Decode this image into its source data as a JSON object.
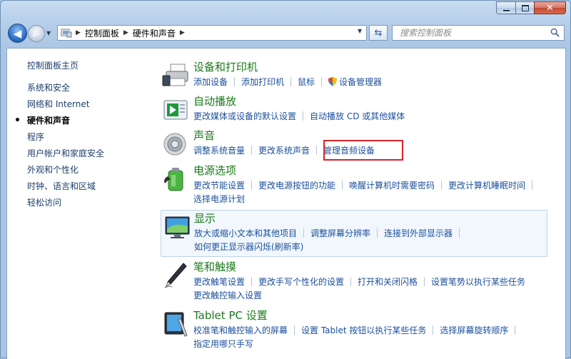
{
  "navigation": {
    "address_crumbs": [
      "控制面板",
      "硬件和声音"
    ],
    "search_placeholder": "搜索控制面板"
  },
  "sidebar": {
    "items": [
      {
        "label": "控制面板主页"
      },
      {
        "label": "系统和安全"
      },
      {
        "label": "网络和 Internet"
      },
      {
        "label": "硬件和声音",
        "current": true
      },
      {
        "label": "程序"
      },
      {
        "label": "用户帐户和家庭安全"
      },
      {
        "label": "外观和个性化"
      },
      {
        "label": "时钟、语言和区域"
      },
      {
        "label": "轻松访问"
      }
    ]
  },
  "categories": [
    {
      "title": "设备和打印机",
      "icon": "printer-icon",
      "links": [
        "添加设备",
        "添加打印机",
        "鼠标",
        "设备管理器"
      ]
    },
    {
      "title": "自动播放",
      "icon": "autoplay-icon",
      "links": [
        "更改媒体或设备的默认设置",
        "自动播放 CD 或其他媒体"
      ]
    },
    {
      "title": "声音",
      "icon": "speaker-icon",
      "links": [
        "调整系统音量",
        "更改系统声音",
        "管理音频设备"
      ]
    },
    {
      "title": "电源选项",
      "icon": "battery-icon",
      "links": [
        "更改节能设置",
        "更改电源按钮的功能",
        "唤醒计算机时需要密码",
        "更改计算机睡眠时间",
        "选择电源计划"
      ]
    },
    {
      "title": "显示",
      "icon": "monitor-icon",
      "links": [
        "放大或缩小文本和其他项目",
        "调整屏幕分辨率",
        "连接到外部显示器",
        "如何更正显示器闪烁(刷新率)"
      ]
    },
    {
      "title": "笔和触摸",
      "icon": "pen-icon",
      "links": [
        "更改触笔设置",
        "更改手写个性化的设置",
        "打开和关闭闪格",
        "设置笔势以执行某些任务",
        "更改触控输入设置"
      ]
    },
    {
      "title": "Tablet PC 设置",
      "icon": "tablet-icon",
      "links": [
        "校准笔和触控输入的屏幕",
        "设置 Tablet 按钮以执行某些任务",
        "选择屏幕旋转顺序",
        "指定用哪只手写"
      ]
    }
  ],
  "colors": {
    "category_title": "#1a7a1a",
    "link": "#1b4f9c",
    "highlight_box": "#d8232a"
  }
}
